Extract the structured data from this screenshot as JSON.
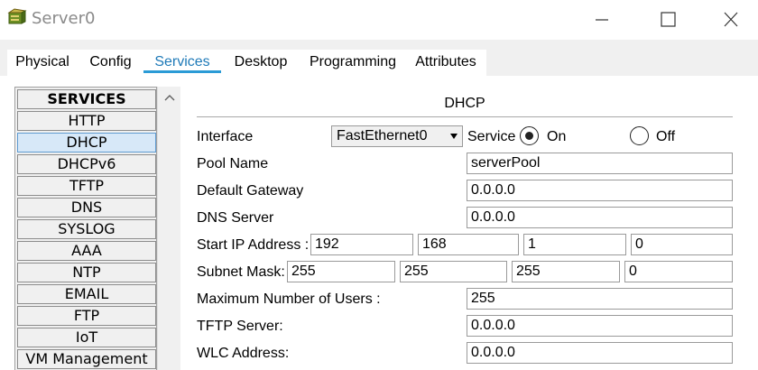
{
  "window": {
    "title": "Server0",
    "icon": "server-app-icon",
    "controls": [
      "minimize-icon",
      "maximize-icon",
      "close-icon"
    ]
  },
  "tabs": [
    "Physical",
    "Config",
    "Services",
    "Desktop",
    "Programming",
    "Attributes"
  ],
  "active_tab": "Services",
  "sidebar": {
    "header": "SERVICES",
    "items": [
      "HTTP",
      "DHCP",
      "DHCPv6",
      "TFTP",
      "DNS",
      "SYSLOG",
      "AAA",
      "NTP",
      "EMAIL",
      "FTP",
      "IoT",
      "VM Management"
    ],
    "selected": "DHCP"
  },
  "dhcp": {
    "title": "DHCP",
    "interface_label": "Interface",
    "interface_value": "FastEthernet0",
    "service_label": "Service",
    "on_label": "On",
    "off_label": "Off",
    "service_state": "On",
    "pool_name_label": "Pool Name",
    "pool_name_value": "serverPool",
    "default_gateway_label": "Default Gateway",
    "default_gateway_value": "0.0.0.0",
    "dns_server_label": "DNS Server",
    "dns_server_value": "0.0.0.0",
    "start_ip_label": "Start IP Address :",
    "start_ip": [
      "192",
      "168",
      "1",
      "0"
    ],
    "subnet_mask_label": "Subnet Mask:",
    "subnet_mask": [
      "255",
      "255",
      "255",
      "0"
    ],
    "max_users_label": "Maximum Number of Users :",
    "max_users_value": "255",
    "tftp_server_label": "TFTP Server:",
    "tftp_server_value": "0.0.0.0",
    "wlc_address_label": "WLC Address:",
    "wlc_address_value": "0.0.0.0"
  },
  "colors": {
    "active_tab_text": "#1f7ab8",
    "active_tab_underline": "#2b9bd6",
    "selected_item_bg": "#d7e8f8"
  }
}
